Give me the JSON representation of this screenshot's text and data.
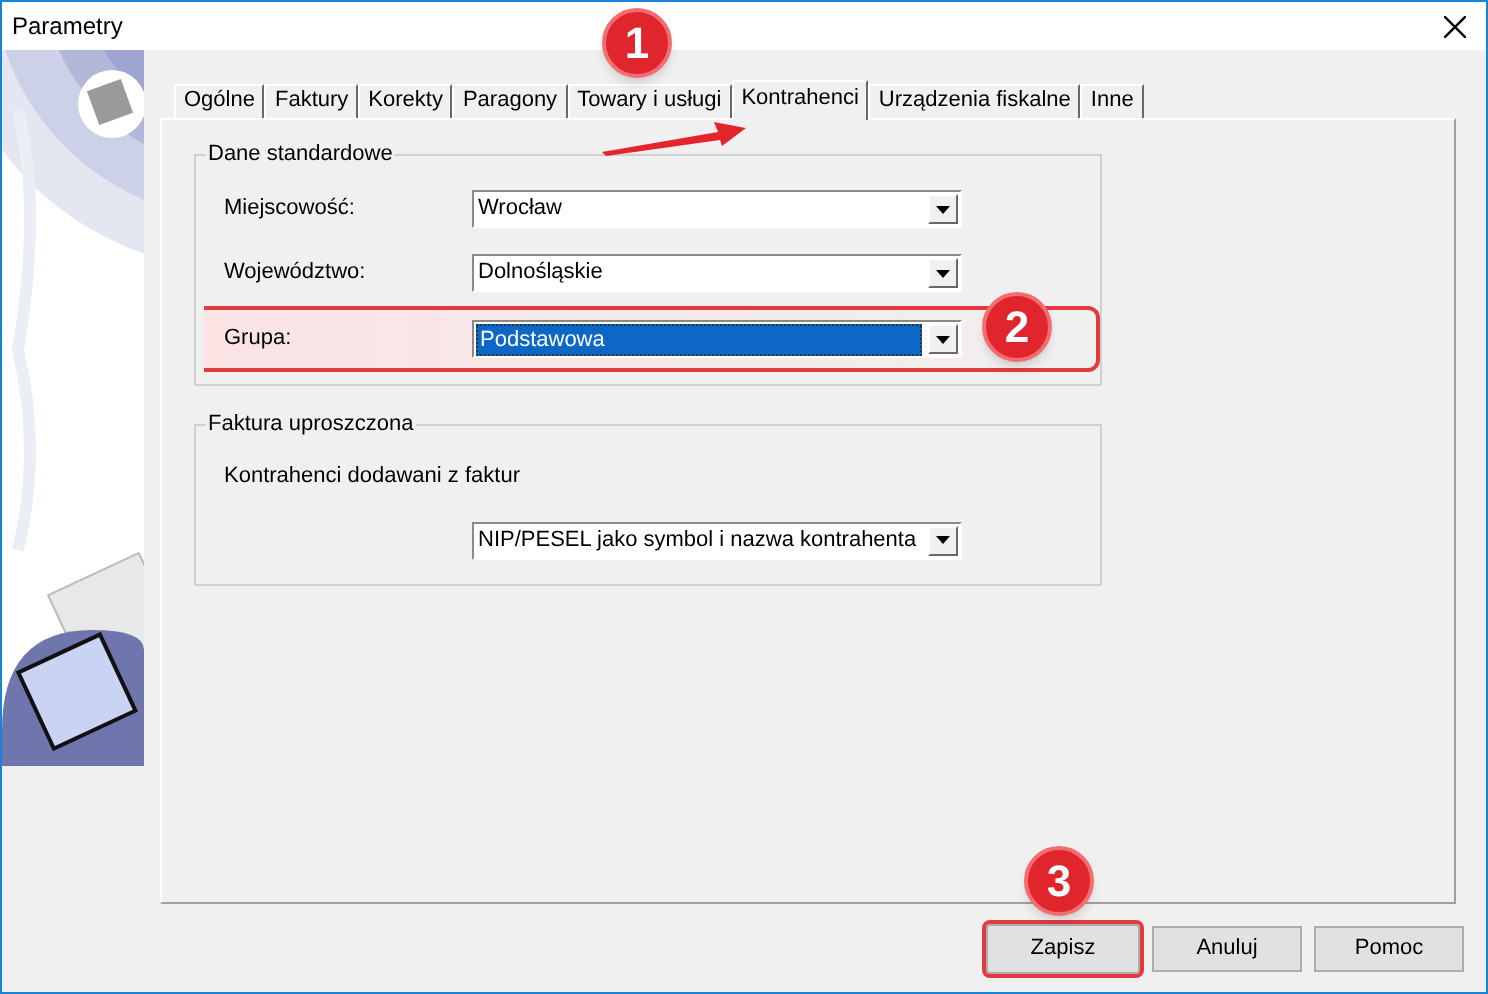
{
  "window": {
    "title": "Parametry"
  },
  "tabs": [
    {
      "label": "Ogólne",
      "selected": false
    },
    {
      "label": "Faktury",
      "selected": false
    },
    {
      "label": "Korekty",
      "selected": false
    },
    {
      "label": "Paragony",
      "selected": false
    },
    {
      "label": "Towary i usługi",
      "selected": false
    },
    {
      "label": "Kontrahenci",
      "selected": true
    },
    {
      "label": "Urządzenia fiskalne",
      "selected": false
    },
    {
      "label": "Inne",
      "selected": false
    }
  ],
  "groups": [
    {
      "title": "Dane standardowe",
      "kind": "fields",
      "fields": [
        {
          "label": "Miejscowość:",
          "value": "Wrocław",
          "selected": false,
          "highlighted": false
        },
        {
          "label": "Województwo:",
          "value": "Dolnośląskie",
          "selected": false,
          "highlighted": false
        },
        {
          "label": "Grupa:",
          "value": "Podstawowa",
          "selected": true,
          "highlighted": true
        }
      ]
    },
    {
      "title": "Faktura uproszczona",
      "kind": "stacked",
      "fields": [
        {
          "label": "Kontrahenci dodawani z faktur",
          "value": "NIP/PESEL jako symbol i nazwa kontrahenta",
          "selected": false,
          "highlighted": false
        }
      ]
    }
  ],
  "buttons": [
    {
      "label": "Zapisz",
      "highlighted": true
    },
    {
      "label": "Anuluj",
      "highlighted": false
    },
    {
      "label": "Pomoc",
      "highlighted": false
    }
  ],
  "callouts": [
    {
      "label": "1"
    },
    {
      "label": "2"
    },
    {
      "label": "3"
    }
  ]
}
